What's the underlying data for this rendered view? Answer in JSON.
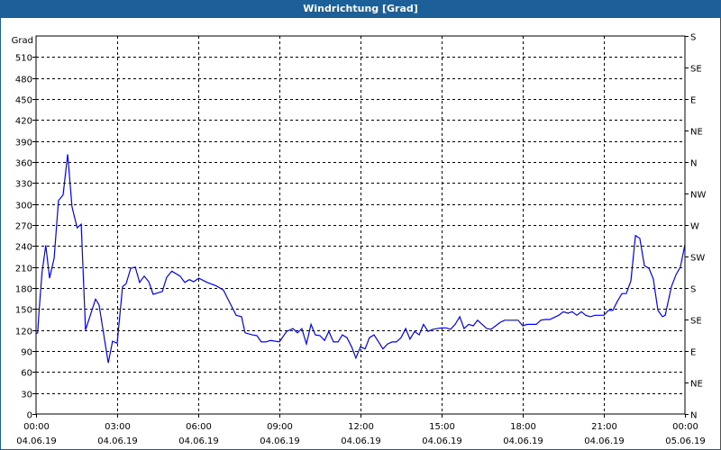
{
  "window": {
    "title": "Windrichtung [Grad]"
  },
  "chart_data": {
    "type": "line",
    "title": "Windrichtung [Grad]",
    "ylabel": "Grad",
    "ylim": [
      0,
      540
    ],
    "xlim_hours": [
      0,
      24
    ],
    "grid": true,
    "y_ticks": [
      0,
      30,
      60,
      90,
      120,
      150,
      180,
      210,
      240,
      270,
      300,
      330,
      360,
      390,
      420,
      450,
      480,
      510
    ],
    "right_axis_ticks": [
      {
        "value": 0,
        "label": "N"
      },
      {
        "value": 45,
        "label": "NE"
      },
      {
        "value": 90,
        "label": "E"
      },
      {
        "value": 135,
        "label": "SE"
      },
      {
        "value": 180,
        "label": "S"
      },
      {
        "value": 225,
        "label": "SW"
      },
      {
        "value": 270,
        "label": "W"
      },
      {
        "value": 315,
        "label": "NW"
      },
      {
        "value": 360,
        "label": "N"
      },
      {
        "value": 405,
        "label": "NE"
      },
      {
        "value": 450,
        "label": "E"
      },
      {
        "value": 495,
        "label": "SE"
      },
      {
        "value": 540,
        "label": "S"
      }
    ],
    "x_ticks": [
      {
        "hour": 0,
        "time": "00:00",
        "date": "04.06.19"
      },
      {
        "hour": 3,
        "time": "03:00",
        "date": "04.06.19"
      },
      {
        "hour": 6,
        "time": "06:00",
        "date": "04.06.19"
      },
      {
        "hour": 9,
        "time": "09:00",
        "date": "04.06.19"
      },
      {
        "hour": 12,
        "time": "12:00",
        "date": "04.06.19"
      },
      {
        "hour": 15,
        "time": "15:00",
        "date": "04.06.19"
      },
      {
        "hour": 18,
        "time": "18:00",
        "date": "04.06.19"
      },
      {
        "hour": 21,
        "time": "21:00",
        "date": "04.06.19"
      },
      {
        "hour": 24,
        "time": "00:00",
        "date": "05.06.19"
      }
    ],
    "series": [
      {
        "name": "Windrichtung",
        "color": "#0000ff",
        "points": [
          [
            0,
            115
          ],
          [
            0.06,
            116
          ],
          [
            0.11,
            146
          ],
          [
            0.22,
            202
          ],
          [
            0.36,
            241
          ],
          [
            0.5,
            194
          ],
          [
            0.67,
            223
          ],
          [
            0.83,
            305
          ],
          [
            1.0,
            313
          ],
          [
            1.17,
            371
          ],
          [
            1.33,
            296
          ],
          [
            1.52,
            266
          ],
          [
            1.67,
            271
          ],
          [
            1.83,
            120
          ],
          [
            2.2,
            164
          ],
          [
            2.33,
            156
          ],
          [
            2.67,
            73
          ],
          [
            2.83,
            104
          ],
          [
            3.0,
            101
          ],
          [
            3.2,
            182
          ],
          [
            3.33,
            186
          ],
          [
            3.5,
            208
          ],
          [
            3.67,
            210
          ],
          [
            3.83,
            188
          ],
          [
            4.0,
            197
          ],
          [
            4.17,
            189
          ],
          [
            4.33,
            171
          ],
          [
            4.67,
            175
          ],
          [
            4.83,
            195
          ],
          [
            5.02,
            204
          ],
          [
            5.33,
            197
          ],
          [
            5.5,
            188
          ],
          [
            5.67,
            192
          ],
          [
            5.83,
            189
          ],
          [
            6.02,
            194
          ],
          [
            6.33,
            188
          ],
          [
            6.67,
            183
          ],
          [
            6.93,
            177
          ],
          [
            7.4,
            141
          ],
          [
            7.6,
            139
          ],
          [
            7.73,
            116
          ],
          [
            8.0,
            113
          ],
          [
            8.17,
            112
          ],
          [
            8.33,
            103
          ],
          [
            8.5,
            103
          ],
          [
            8.67,
            105
          ],
          [
            9.0,
            103
          ],
          [
            9.27,
            118
          ],
          [
            9.5,
            122
          ],
          [
            9.67,
            116
          ],
          [
            9.83,
            122
          ],
          [
            10.0,
            100
          ],
          [
            10.17,
            128
          ],
          [
            10.33,
            113
          ],
          [
            10.5,
            112
          ],
          [
            10.67,
            105
          ],
          [
            10.83,
            118
          ],
          [
            11.0,
            103
          ],
          [
            11.17,
            103
          ],
          [
            11.33,
            113
          ],
          [
            11.5,
            109
          ],
          [
            11.67,
            96
          ],
          [
            11.83,
            80
          ],
          [
            12.0,
            96
          ],
          [
            12.17,
            93
          ],
          [
            12.33,
            109
          ],
          [
            12.5,
            113
          ],
          [
            12.67,
            103
          ],
          [
            12.83,
            93
          ],
          [
            13.0,
            100
          ],
          [
            13.17,
            103
          ],
          [
            13.33,
            103
          ],
          [
            13.5,
            109
          ],
          [
            13.67,
            122
          ],
          [
            13.83,
            107
          ],
          [
            14.0,
            118
          ],
          [
            14.17,
            113
          ],
          [
            14.33,
            128
          ],
          [
            14.5,
            118
          ],
          [
            14.67,
            121
          ],
          [
            15.0,
            123
          ],
          [
            15.17,
            123
          ],
          [
            15.33,
            121
          ],
          [
            15.5,
            128
          ],
          [
            15.67,
            139
          ],
          [
            15.83,
            122
          ],
          [
            16.0,
            128
          ],
          [
            16.17,
            126
          ],
          [
            16.33,
            134
          ],
          [
            16.5,
            128
          ],
          [
            16.67,
            122
          ],
          [
            16.83,
            121
          ],
          [
            17.0,
            126
          ],
          [
            17.17,
            131
          ],
          [
            17.33,
            134
          ],
          [
            17.67,
            134
          ],
          [
            17.83,
            134
          ],
          [
            18.0,
            126
          ],
          [
            18.17,
            128
          ],
          [
            18.33,
            128
          ],
          [
            18.5,
            128
          ],
          [
            18.67,
            134
          ],
          [
            18.83,
            135
          ],
          [
            19.0,
            135
          ],
          [
            19.33,
            141
          ],
          [
            19.5,
            146
          ],
          [
            19.67,
            144
          ],
          [
            19.83,
            146
          ],
          [
            20.0,
            141
          ],
          [
            20.17,
            146
          ],
          [
            20.33,
            141
          ],
          [
            20.5,
            139
          ],
          [
            20.67,
            141
          ],
          [
            20.83,
            141
          ],
          [
            21.0,
            141
          ],
          [
            21.17,
            148
          ],
          [
            21.33,
            148
          ],
          [
            21.5,
            161
          ],
          [
            21.67,
            172
          ],
          [
            21.83,
            172
          ],
          [
            22.0,
            190
          ],
          [
            22.17,
            255
          ],
          [
            22.33,
            251
          ],
          [
            22.5,
            212
          ],
          [
            22.67,
            208
          ],
          [
            22.83,
            193
          ],
          [
            23.0,
            148
          ],
          [
            23.17,
            139
          ],
          [
            23.27,
            141
          ],
          [
            23.5,
            182
          ],
          [
            23.67,
            199
          ],
          [
            23.83,
            210
          ],
          [
            24.0,
            242
          ]
        ]
      }
    ]
  }
}
